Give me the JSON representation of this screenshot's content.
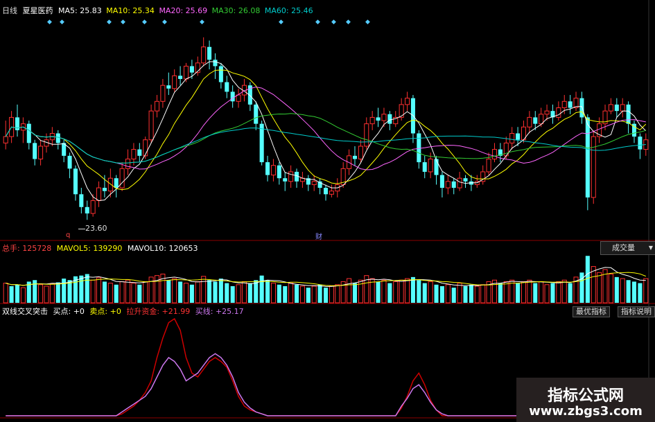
{
  "kline_header": {
    "period": "日线",
    "stock_name": "夏星医药",
    "ma": [
      {
        "label": "MA5: 25.83",
        "color": "#ffffff"
      },
      {
        "label": "MA10: 25.34",
        "color": "#ffff00"
      },
      {
        "label": "MA20: 25.69",
        "color": "#ff66ff"
      },
      {
        "label": "MA30: 26.08",
        "color": "#33cc33"
      },
      {
        "label": "MA60: 25.46",
        "color": "#00cccc"
      }
    ]
  },
  "kline": {
    "low_marker": "23.60",
    "q_marker": "q",
    "cai_marker": "财"
  },
  "volume_header": {
    "total_label": "总手: 125728",
    "mavol5_label": "MAVOL5: 139290",
    "mavol10_label": "MAVOL10: 120653",
    "dropdown_label": "成交量"
  },
  "indicator_header": {
    "title": "双线交叉突击",
    "buy_label": "买点: +0",
    "sell_label": "卖点: +0",
    "raise_label": "拉升资金: +21.99",
    "buyline_label": "买线: +25.17",
    "btn_best": "最优指标",
    "btn_desc": "指标说明"
  },
  "watermark": {
    "title": "指标公式网",
    "url": "www.zbgs3.com"
  },
  "colors": {
    "up": "#ff3030",
    "down": "#55ffff",
    "grid_red": "#8b0000",
    "ma5": "#ffffff",
    "ma10": "#ffff00",
    "ma20": "#ff66ff",
    "ma30": "#33cc33",
    "ma60": "#00cccc",
    "raise": "#cc0000",
    "buyline": "#cc77ee"
  },
  "chart_data": {
    "type": "candlestick",
    "ylim": [
      23.0,
      29.6
    ],
    "low_value": 23.6,
    "candles": [
      [
        26.0,
        26.2,
        26.7,
        25.8
      ],
      [
        26.2,
        26.8,
        27.0,
        26.0
      ],
      [
        26.8,
        26.4,
        27.2,
        26.2
      ],
      [
        26.4,
        26.6,
        26.8,
        26.0
      ],
      [
        26.6,
        26.0,
        26.7,
        25.8
      ],
      [
        26.0,
        25.5,
        26.1,
        25.3
      ],
      [
        25.5,
        25.9,
        26.1,
        25.3
      ],
      [
        25.9,
        26.1,
        26.3,
        25.7
      ],
      [
        26.1,
        26.3,
        26.5,
        25.9
      ],
      [
        26.3,
        26.0,
        26.4,
        25.8
      ],
      [
        26.0,
        25.6,
        26.1,
        25.4
      ],
      [
        25.6,
        25.2,
        25.7,
        24.9
      ],
      [
        25.2,
        24.4,
        25.3,
        24.2
      ],
      [
        24.4,
        24.0,
        24.6,
        23.8
      ],
      [
        24.0,
        23.8,
        24.2,
        23.6
      ],
      [
        23.8,
        24.2,
        24.4,
        23.7
      ],
      [
        24.2,
        24.6,
        24.8,
        24.0
      ],
      [
        24.6,
        24.5,
        25.0,
        24.3
      ],
      [
        24.5,
        24.9,
        25.2,
        24.3
      ],
      [
        24.9,
        24.6,
        25.0,
        24.3
      ],
      [
        24.6,
        25.2,
        25.4,
        24.5
      ],
      [
        25.2,
        25.5,
        25.8,
        25.0
      ],
      [
        25.5,
        25.8,
        26.0,
        25.3
      ],
      [
        25.8,
        25.6,
        26.0,
        25.4
      ],
      [
        25.6,
        26.1,
        26.2,
        25.5
      ],
      [
        26.1,
        27.0,
        27.2,
        26.0
      ],
      [
        27.0,
        27.3,
        27.5,
        26.8
      ],
      [
        27.3,
        27.8,
        28.0,
        27.1
      ],
      [
        27.8,
        27.7,
        28.2,
        27.5
      ],
      [
        27.7,
        28.1,
        28.3,
        27.6
      ],
      [
        28.1,
        28.0,
        28.4,
        27.8
      ],
      [
        28.0,
        28.4,
        28.5,
        27.9
      ],
      [
        28.4,
        28.2,
        28.6,
        28.0
      ],
      [
        28.2,
        28.5,
        28.7,
        28.1
      ],
      [
        28.5,
        29.0,
        29.3,
        28.4
      ],
      [
        29.0,
        28.6,
        29.2,
        28.3
      ],
      [
        28.6,
        28.4,
        28.8,
        28.0
      ],
      [
        28.4,
        27.9,
        28.5,
        27.7
      ],
      [
        27.9,
        27.6,
        28.1,
        27.4
      ],
      [
        27.6,
        27.3,
        27.8,
        27.1
      ],
      [
        27.3,
        27.5,
        27.7,
        27.1
      ],
      [
        27.5,
        27.8,
        28.0,
        27.3
      ],
      [
        27.8,
        27.2,
        27.9,
        27.0
      ],
      [
        27.2,
        26.6,
        27.3,
        26.4
      ],
      [
        26.6,
        25.4,
        26.7,
        25.3
      ],
      [
        25.4,
        25.0,
        25.6,
        24.8
      ],
      [
        25.0,
        25.3,
        25.5,
        24.8
      ],
      [
        25.3,
        24.9,
        25.4,
        24.7
      ],
      [
        24.9,
        24.8,
        25.1,
        24.5
      ],
      [
        24.8,
        25.1,
        25.3,
        24.6
      ],
      [
        25.1,
        24.8,
        25.2,
        24.6
      ],
      [
        24.8,
        24.9,
        25.1,
        24.6
      ],
      [
        24.9,
        24.7,
        25.0,
        24.5
      ],
      [
        24.7,
        24.8,
        25.0,
        24.5
      ],
      [
        24.8,
        24.6,
        24.9,
        24.4
      ],
      [
        24.6,
        24.4,
        24.7,
        24.2
      ],
      [
        24.4,
        24.5,
        24.7,
        24.3
      ],
      [
        24.5,
        24.7,
        24.9,
        24.3
      ],
      [
        24.7,
        25.2,
        25.4,
        24.6
      ],
      [
        25.2,
        25.6,
        25.8,
        25.0
      ],
      [
        25.6,
        25.5,
        25.9,
        25.3
      ],
      [
        25.5,
        25.9,
        26.1,
        25.4
      ],
      [
        25.9,
        26.6,
        26.8,
        25.8
      ],
      [
        26.6,
        26.8,
        27.0,
        26.4
      ],
      [
        26.8,
        26.7,
        27.1,
        26.5
      ],
      [
        26.7,
        26.9,
        27.1,
        26.5
      ],
      [
        26.9,
        26.6,
        27.0,
        26.4
      ],
      [
        26.6,
        26.8,
        27.0,
        26.5
      ],
      [
        26.8,
        27.2,
        27.4,
        26.7
      ],
      [
        27.2,
        27.4,
        27.6,
        27.0
      ],
      [
        27.4,
        26.3,
        27.5,
        26.0
      ],
      [
        26.3,
        25.4,
        26.4,
        25.2
      ],
      [
        25.4,
        25.1,
        25.6,
        24.9
      ],
      [
        25.1,
        25.5,
        25.7,
        24.9
      ],
      [
        25.5,
        25.0,
        25.6,
        24.7
      ],
      [
        25.0,
        24.6,
        25.1,
        24.3
      ],
      [
        24.6,
        24.8,
        25.0,
        24.4
      ],
      [
        24.8,
        24.6,
        24.9,
        24.4
      ],
      [
        24.6,
        24.9,
        25.1,
        24.5
      ],
      [
        24.9,
        24.8,
        25.0,
        24.6
      ],
      [
        24.8,
        24.7,
        25.0,
        24.5
      ],
      [
        24.7,
        24.8,
        25.0,
        24.6
      ],
      [
        24.8,
        25.1,
        25.3,
        24.7
      ],
      [
        25.1,
        25.5,
        25.7,
        25.0
      ],
      [
        25.5,
        25.8,
        26.0,
        25.4
      ],
      [
        25.8,
        25.6,
        26.0,
        25.4
      ],
      [
        25.6,
        26.0,
        26.2,
        25.5
      ],
      [
        26.0,
        26.3,
        26.5,
        25.8
      ],
      [
        26.3,
        26.1,
        26.5,
        25.9
      ],
      [
        26.1,
        26.5,
        26.7,
        26.0
      ],
      [
        26.5,
        26.8,
        27.0,
        26.3
      ],
      [
        26.8,
        26.6,
        27.0,
        26.4
      ],
      [
        26.6,
        26.9,
        27.1,
        26.5
      ],
      [
        26.9,
        27.0,
        27.2,
        26.7
      ],
      [
        27.0,
        26.8,
        27.2,
        26.6
      ],
      [
        26.8,
        27.1,
        27.3,
        26.7
      ],
      [
        27.1,
        27.3,
        27.5,
        26.9
      ],
      [
        27.3,
        27.1,
        27.5,
        26.9
      ],
      [
        27.1,
        27.4,
        27.6,
        27.0
      ],
      [
        27.4,
        26.8,
        27.6,
        26.6
      ],
      [
        26.8,
        24.3,
        26.9,
        23.9
      ],
      [
        24.3,
        26.2,
        26.4,
        24.1
      ],
      [
        26.2,
        26.6,
        26.8,
        26.0
      ],
      [
        26.6,
        27.0,
        27.2,
        26.4
      ],
      [
        27.0,
        27.2,
        27.4,
        26.9
      ],
      [
        27.2,
        27.0,
        27.4,
        26.8
      ],
      [
        27.0,
        27.2,
        27.4,
        26.8
      ],
      [
        27.2,
        26.6,
        27.3,
        26.3
      ],
      [
        26.6,
        26.2,
        26.7,
        26.0
      ],
      [
        26.2,
        25.8,
        26.3,
        25.5
      ],
      [
        25.8,
        26.1,
        26.3,
        25.6
      ]
    ],
    "volume": [
      [
        26,
        1
      ],
      [
        22,
        0
      ],
      [
        24,
        0
      ],
      [
        20,
        1
      ],
      [
        28,
        0
      ],
      [
        30,
        0
      ],
      [
        24,
        1
      ],
      [
        22,
        1
      ],
      [
        25,
        1
      ],
      [
        27,
        0
      ],
      [
        32,
        0
      ],
      [
        30,
        0
      ],
      [
        35,
        0
      ],
      [
        36,
        0
      ],
      [
        38,
        0
      ],
      [
        30,
        1
      ],
      [
        33,
        1
      ],
      [
        28,
        0
      ],
      [
        26,
        1
      ],
      [
        24,
        0
      ],
      [
        28,
        1
      ],
      [
        30,
        1
      ],
      [
        26,
        1
      ],
      [
        24,
        0
      ],
      [
        28,
        1
      ],
      [
        34,
        1
      ],
      [
        36,
        1
      ],
      [
        38,
        1
      ],
      [
        30,
        0
      ],
      [
        32,
        1
      ],
      [
        28,
        0
      ],
      [
        26,
        1
      ],
      [
        24,
        0
      ],
      [
        28,
        1
      ],
      [
        35,
        1
      ],
      [
        30,
        0
      ],
      [
        28,
        0
      ],
      [
        32,
        0
      ],
      [
        26,
        0
      ],
      [
        22,
        0
      ],
      [
        24,
        1
      ],
      [
        28,
        1
      ],
      [
        26,
        0
      ],
      [
        30,
        0
      ],
      [
        36,
        0
      ],
      [
        30,
        0
      ],
      [
        26,
        1
      ],
      [
        24,
        0
      ],
      [
        22,
        0
      ],
      [
        26,
        1
      ],
      [
        24,
        0
      ],
      [
        22,
        1
      ],
      [
        20,
        0
      ],
      [
        22,
        1
      ],
      [
        24,
        0
      ],
      [
        20,
        0
      ],
      [
        22,
        1
      ],
      [
        24,
        1
      ],
      [
        28,
        1
      ],
      [
        32,
        1
      ],
      [
        26,
        0
      ],
      [
        30,
        1
      ],
      [
        36,
        1
      ],
      [
        32,
        1
      ],
      [
        28,
        0
      ],
      [
        30,
        1
      ],
      [
        26,
        0
      ],
      [
        28,
        1
      ],
      [
        30,
        1
      ],
      [
        32,
        1
      ],
      [
        34,
        0
      ],
      [
        30,
        0
      ],
      [
        26,
        0
      ],
      [
        28,
        1
      ],
      [
        24,
        0
      ],
      [
        22,
        0
      ],
      [
        24,
        1
      ],
      [
        20,
        0
      ],
      [
        26,
        1
      ],
      [
        22,
        0
      ],
      [
        24,
        0
      ],
      [
        22,
        1
      ],
      [
        24,
        1
      ],
      [
        28,
        1
      ],
      [
        30,
        1
      ],
      [
        26,
        0
      ],
      [
        28,
        1
      ],
      [
        30,
        1
      ],
      [
        26,
        0
      ],
      [
        28,
        1
      ],
      [
        30,
        1
      ],
      [
        26,
        0
      ],
      [
        28,
        1
      ],
      [
        24,
        1
      ],
      [
        26,
        0
      ],
      [
        28,
        1
      ],
      [
        30,
        1
      ],
      [
        26,
        0
      ],
      [
        34,
        1
      ],
      [
        40,
        0
      ],
      [
        62,
        0
      ],
      [
        48,
        1
      ],
      [
        40,
        1
      ],
      [
        44,
        1
      ],
      [
        38,
        1
      ],
      [
        34,
        0
      ],
      [
        32,
        1
      ],
      [
        30,
        0
      ],
      [
        28,
        0
      ],
      [
        26,
        0
      ],
      [
        32,
        1
      ]
    ],
    "raise_line": [
      0,
      0,
      0,
      0,
      0,
      0,
      0,
      0,
      0,
      0,
      0,
      0,
      0,
      0,
      0,
      0,
      0,
      0,
      0,
      0,
      1,
      3,
      5,
      8,
      12,
      18,
      30,
      40,
      48,
      50,
      44,
      30,
      22,
      20,
      24,
      28,
      30,
      28,
      25,
      18,
      10,
      5,
      3,
      2,
      1,
      0,
      0,
      0,
      0,
      0,
      0,
      0,
      0,
      0,
      0,
      0,
      0,
      0,
      0,
      0,
      0,
      0,
      0,
      0,
      0,
      0,
      0,
      0,
      4,
      10,
      18,
      22,
      16,
      8,
      3,
      0,
      0,
      0,
      0,
      0,
      0,
      0,
      0,
      0,
      0,
      0,
      0,
      0,
      0,
      0,
      0,
      0,
      0,
      0,
      0,
      0,
      0,
      0,
      0,
      0,
      0,
      0,
      0,
      0,
      0,
      0,
      0,
      0,
      0,
      0,
      0
    ],
    "buy_line": [
      0,
      0,
      0,
      0,
      0,
      0,
      0,
      0,
      0,
      0,
      0,
      0,
      0,
      0,
      0,
      0,
      0,
      0,
      0,
      0,
      2,
      4,
      6,
      8,
      10,
      14,
      20,
      26,
      30,
      28,
      24,
      18,
      20,
      22,
      26,
      30,
      32,
      30,
      26,
      20,
      12,
      7,
      4,
      2,
      1,
      0,
      0,
      0,
      0,
      0,
      0,
      0,
      0,
      0,
      0,
      0,
      0,
      0,
      0,
      0,
      0,
      0,
      0,
      0,
      0,
      0,
      0,
      0,
      5,
      9,
      14,
      16,
      12,
      7,
      3,
      1,
      0,
      0,
      0,
      0,
      0,
      0,
      0,
      0,
      0,
      0,
      0,
      0,
      0,
      0,
      0,
      0,
      0,
      0,
      0,
      0,
      0,
      0,
      0,
      0,
      0,
      0,
      0,
      0,
      0,
      0,
      0,
      0,
      0,
      0,
      0
    ]
  }
}
